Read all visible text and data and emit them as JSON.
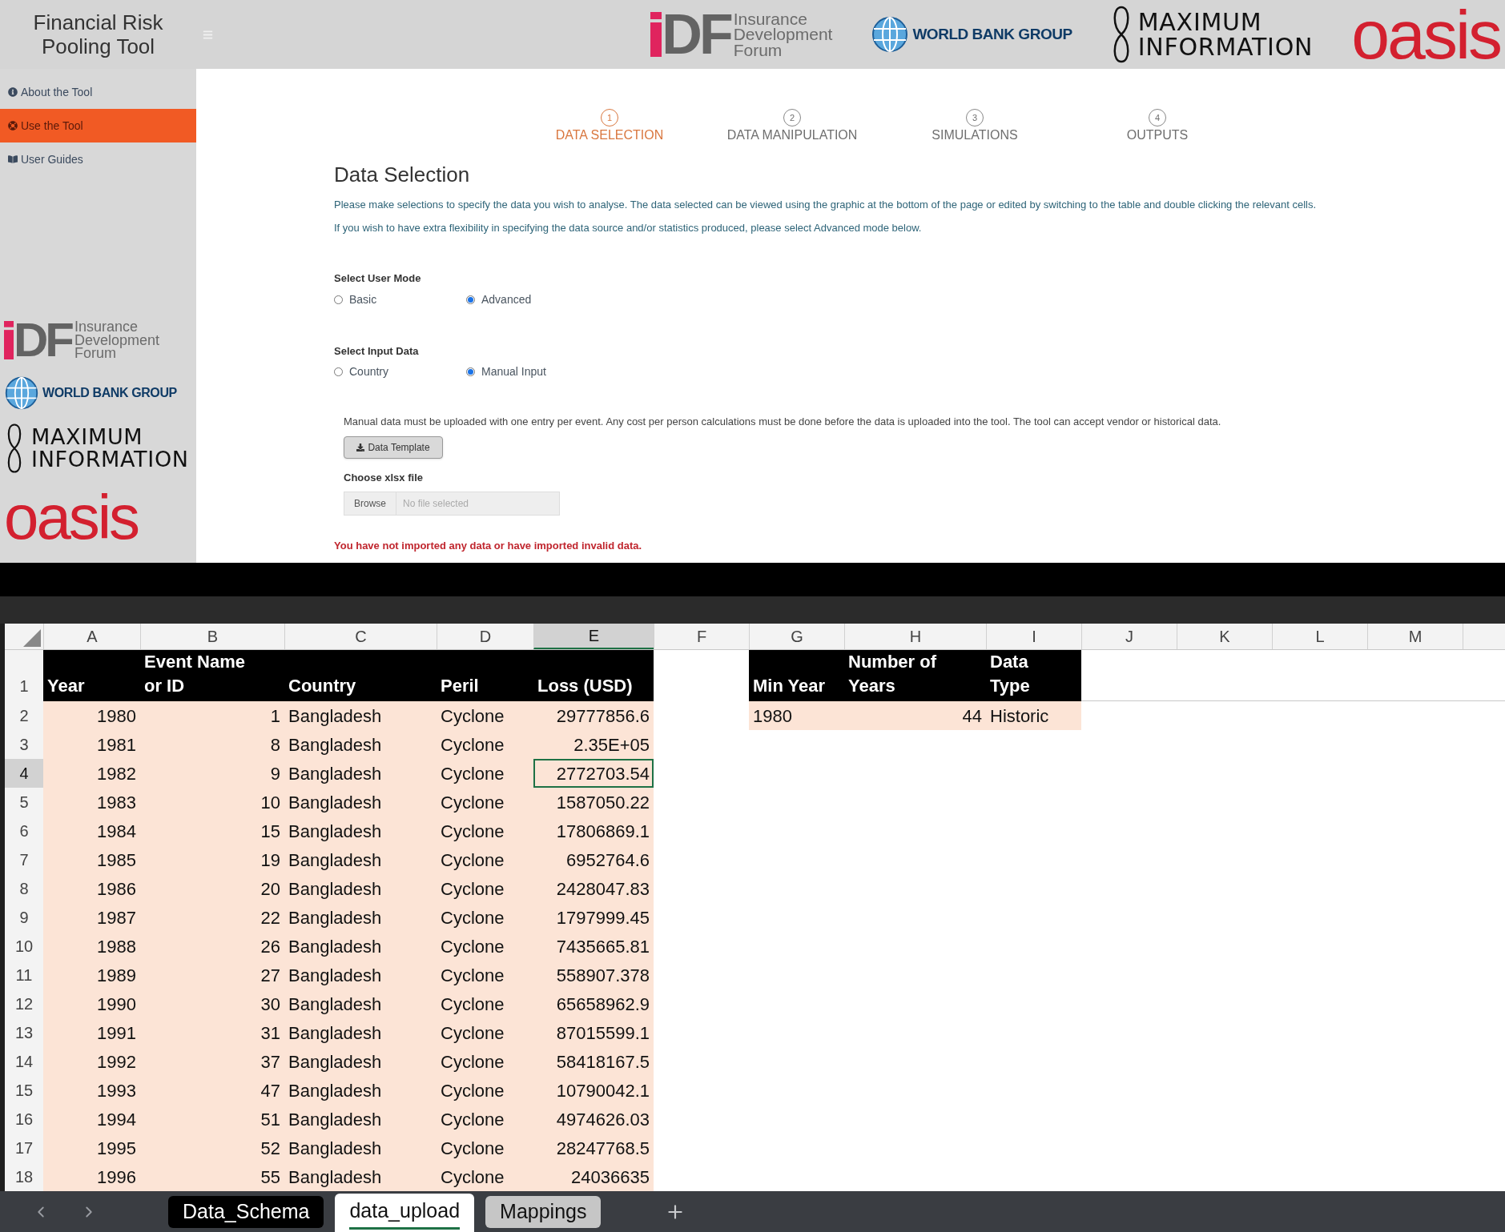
{
  "header": {
    "title": "Financial Risk Pooling Tool",
    "logos": [
      {
        "kind": "idf",
        "mark": "DF",
        "lines": [
          "Insurance",
          "Development",
          "Forum"
        ]
      },
      {
        "kind": "wbg",
        "lines": [
          "WORLD BANK GROUP"
        ]
      },
      {
        "kind": "maxinfo",
        "lines": [
          "MAXIMUM",
          "INFORMATION"
        ]
      },
      {
        "kind": "oasis",
        "lines": [
          "oasis"
        ]
      }
    ]
  },
  "sidebar": {
    "items": [
      {
        "kind": "info",
        "label": "About the Tool",
        "selected": false
      },
      {
        "kind": "ring",
        "label": "Use the Tool",
        "selected": true
      },
      {
        "kind": "book",
        "label": "User Guides",
        "selected": false
      }
    ],
    "logos": [
      {
        "kind": "idf",
        "mark": "DF",
        "lines": [
          "Insurance",
          "Development",
          "Forum"
        ]
      },
      {
        "kind": "wbg",
        "lines": [
          "WORLD BANK GROUP"
        ]
      },
      {
        "kind": "maxinfo",
        "lines": [
          "MAXIMUM",
          "INFORMATION"
        ]
      },
      {
        "kind": "oasis",
        "lines": [
          "oasis"
        ]
      }
    ]
  },
  "steps": [
    {
      "number": "1",
      "label": "DATA SELECTION",
      "selected": true
    },
    {
      "number": "2",
      "label": "DATA MANIPULATION",
      "selected": false
    },
    {
      "number": "3",
      "label": "SIMULATIONS",
      "selected": false
    },
    {
      "number": "4",
      "label": "OUTPUTS",
      "selected": false
    }
  ],
  "section": {
    "title": "Data Selection",
    "paragraphs": [
      "Please make selections to specify the data you wish to analyse. The data selected can be viewed using the graphic at the bottom of the page or edited by switching to the table and double clicking the relevant cells.",
      "If you wish to have extra flexibility in specifying the data source and/or statistics produced, please select Advanced mode below."
    ],
    "radio_groups": [
      {
        "label": "Select User Mode",
        "options": [
          {
            "label": "Basic",
            "selected": false
          },
          {
            "label": "Advanced",
            "selected": true
          }
        ]
      },
      {
        "label": "Select Input Data",
        "options": [
          {
            "label": "Country",
            "selected": false
          },
          {
            "label": "Manual Input",
            "selected": true
          }
        ]
      }
    ],
    "manual_note": "Manual data must be uploaded with one entry per event. Any cost per person calculations must be done before the data is uploaded into the tool. The tool can accept vendor or historical data.",
    "template_button": "Data Template",
    "file_input": {
      "label": "Choose xlsx file",
      "button": "Browse",
      "placeholder": "No file selected"
    },
    "error": "You have not imported any data or have imported invalid data."
  },
  "spreadsheet": {
    "columns": [
      {
        "letter": "A",
        "selected": false
      },
      {
        "letter": "B",
        "selected": false
      },
      {
        "letter": "C",
        "selected": false
      },
      {
        "letter": "D",
        "selected": false
      },
      {
        "letter": "E",
        "selected": true
      },
      {
        "letter": "F",
        "selected": false
      },
      {
        "letter": "G",
        "selected": false
      },
      {
        "letter": "H",
        "selected": false
      },
      {
        "letter": "I",
        "selected": false
      },
      {
        "letter": "J",
        "selected": false
      },
      {
        "letter": "K",
        "selected": false
      },
      {
        "letter": "L",
        "selected": false
      },
      {
        "letter": "M",
        "selected": false
      }
    ],
    "heading_row": "1",
    "data_table": {
      "columns": [
        {
          "lines": [
            "Year"
          ],
          "kind": "number"
        },
        {
          "lines": [
            "Event Name",
            "or ID"
          ],
          "kind": "number"
        },
        {
          "lines": [
            "Country"
          ],
          "kind": "text"
        },
        {
          "lines": [
            "Peril"
          ],
          "kind": "text"
        },
        {
          "lines": [
            "Loss (USD)"
          ],
          "kind": "number"
        }
      ],
      "rows": [
        {
          "number": "2",
          "selected": false,
          "cells": [
            "1980",
            "1",
            "Bangladesh",
            "Cyclone",
            "29777856.6"
          ]
        },
        {
          "number": "3",
          "selected": false,
          "cells": [
            "1981",
            "8",
            "Bangladesh",
            "Cyclone",
            "2.35E+05"
          ]
        },
        {
          "number": "4",
          "selected": true,
          "cells": [
            "1982",
            "9",
            "Bangladesh",
            "Cyclone",
            "2772703.54"
          ]
        },
        {
          "number": "5",
          "selected": false,
          "cells": [
            "1983",
            "10",
            "Bangladesh",
            "Cyclone",
            "1587050.22"
          ]
        },
        {
          "number": "6",
          "selected": false,
          "cells": [
            "1984",
            "15",
            "Bangladesh",
            "Cyclone",
            "17806869.1"
          ]
        },
        {
          "number": "7",
          "selected": false,
          "cells": [
            "1985",
            "19",
            "Bangladesh",
            "Cyclone",
            "6952764.6"
          ]
        },
        {
          "number": "8",
          "selected": false,
          "cells": [
            "1986",
            "20",
            "Bangladesh",
            "Cyclone",
            "2428047.83"
          ]
        },
        {
          "number": "9",
          "selected": false,
          "cells": [
            "1987",
            "22",
            "Bangladesh",
            "Cyclone",
            "1797999.45"
          ]
        },
        {
          "number": "10",
          "selected": false,
          "cells": [
            "1988",
            "26",
            "Bangladesh",
            "Cyclone",
            "7435665.81"
          ]
        },
        {
          "number": "11",
          "selected": false,
          "cells": [
            "1989",
            "27",
            "Bangladesh",
            "Cyclone",
            "558907.378"
          ]
        },
        {
          "number": "12",
          "selected": false,
          "cells": [
            "1990",
            "30",
            "Bangladesh",
            "Cyclone",
            "65658962.9"
          ]
        },
        {
          "number": "13",
          "selected": false,
          "cells": [
            "1991",
            "31",
            "Bangladesh",
            "Cyclone",
            "87015599.1"
          ]
        },
        {
          "number": "14",
          "selected": false,
          "cells": [
            "1992",
            "37",
            "Bangladesh",
            "Cyclone",
            "58418167.5"
          ]
        },
        {
          "number": "15",
          "selected": false,
          "cells": [
            "1993",
            "47",
            "Bangladesh",
            "Cyclone",
            "10790042.1"
          ]
        },
        {
          "number": "16",
          "selected": false,
          "cells": [
            "1994",
            "51",
            "Bangladesh",
            "Cyclone",
            "4974626.03"
          ]
        },
        {
          "number": "17",
          "selected": false,
          "cells": [
            "1995",
            "52",
            "Bangladesh",
            "Cyclone",
            "28247768.5"
          ]
        },
        {
          "number": "18",
          "selected": false,
          "cells": [
            "1996",
            "55",
            "Bangladesh",
            "Cyclone",
            "24036635"
          ]
        }
      ]
    },
    "summary_table": {
      "columns": [
        {
          "lines": [
            "Min Year"
          ],
          "kind": "text"
        },
        {
          "lines": [
            "Number of",
            "Years"
          ],
          "kind": "number"
        },
        {
          "lines": [
            "Data",
            "Type"
          ],
          "kind": "text"
        }
      ],
      "rows": [
        {
          "cells": [
            "1980",
            "44",
            "Historic"
          ]
        }
      ]
    },
    "sheet_tabs": [
      {
        "label": "Data_Schema",
        "selected": false,
        "color": "#000000"
      },
      {
        "label": "data_upload",
        "selected": true,
        "color": "#ffffff"
      },
      {
        "label": "Mappings",
        "selected": false,
        "color": "#c6c6c6"
      }
    ]
  }
}
